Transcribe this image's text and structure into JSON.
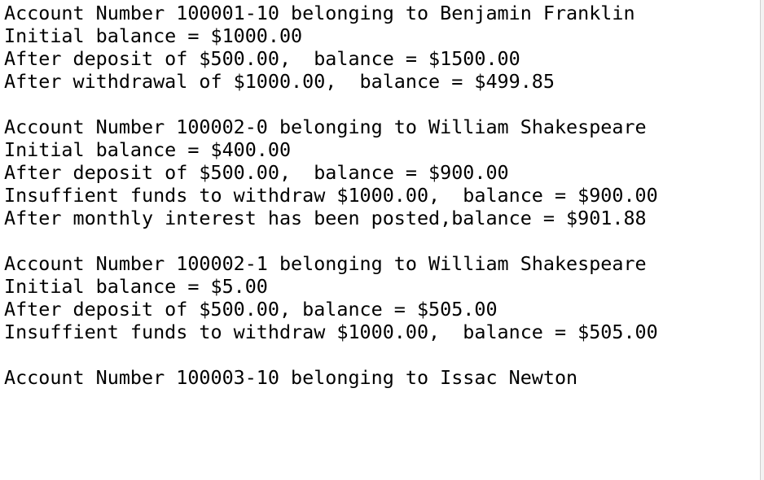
{
  "console": {
    "lines": [
      "Account Number 100001-10 belonging to Benjamin Franklin",
      "Initial balance = $1000.00",
      "After deposit of $500.00,  balance = $1500.00",
      "After withdrawal of $1000.00,  balance = $499.85",
      "",
      "Account Number 100002-0 belonging to William Shakespeare",
      "Initial balance = $400.00",
      "After deposit of $500.00,  balance = $900.00",
      "Insuffient funds to withdraw $1000.00,  balance = $900.00",
      "After monthly interest has been posted,balance = $901.88",
      "",
      "Account Number 100002-1 belonging to William Shakespeare",
      "Initial balance = $5.00",
      "After deposit of $500.00, balance = $505.00",
      "Insuffient funds to withdraw $1000.00,  balance = $505.00",
      "",
      "Account Number 100003-10 belonging to Issac Newton"
    ]
  }
}
